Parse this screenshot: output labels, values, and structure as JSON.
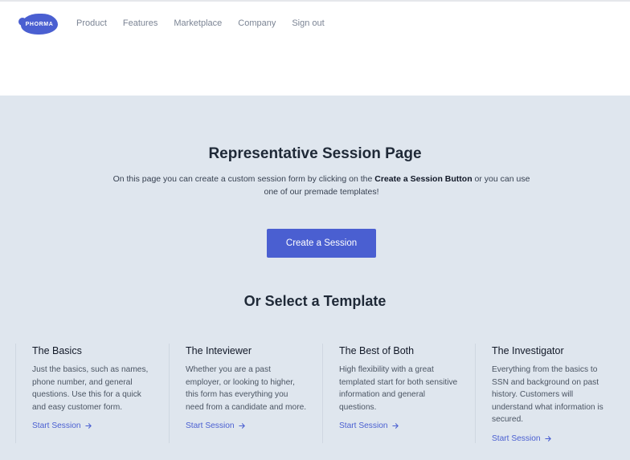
{
  "header": {
    "logo_text": "PHORMA",
    "nav": [
      "Product",
      "Features",
      "Marketplace",
      "Company",
      "Sign out"
    ]
  },
  "main": {
    "title": "Representative Session Page",
    "intro_before": "On this page you can create a custom session form by clicking on the ",
    "intro_bold": "Create a Session Button",
    "intro_after": " or you can use one of our premade templates!",
    "cta_label": "Create a Session",
    "section_title": "Or Select a Template",
    "templates": [
      {
        "title": "The Basics",
        "description": "Just the basics, such as names, phone number, and general questions. Use this for a quick and easy customer form.",
        "link": "Start Session"
      },
      {
        "title": "The Inteviewer",
        "description": "Whether you are a past employer, or looking to higher, this form has everything you need from a candidate and more.",
        "link": "Start Session"
      },
      {
        "title": "The Best of Both",
        "description": "High flexibility with a great templated start for both sensitive information and general questions.",
        "link": "Start Session"
      },
      {
        "title": "The Investigator",
        "description": "Everything from the basics to SSN and background on past history. Customers will understand what information is secured.",
        "link": "Start Session"
      }
    ]
  },
  "colors": {
    "accent": "#4a5fd1",
    "background": "#dfe6ee",
    "nav_text": "#7b8494"
  },
  "icons": {
    "logo": "phorma-blob-logo",
    "link_arrow": "arrow-right-icon"
  }
}
